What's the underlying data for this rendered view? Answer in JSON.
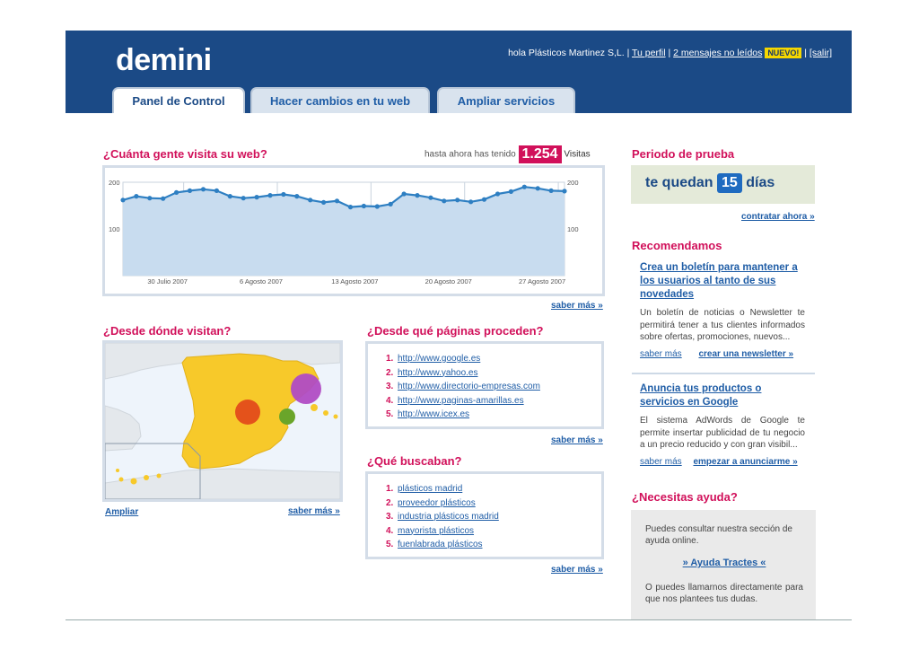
{
  "header": {
    "logo": "demini",
    "greeting": "hola Plásticos Martinez S,L. |",
    "profile_link": "Tu perfil",
    "sep1": "|",
    "messages_link": "2 mensajes no leídos",
    "new_badge": "NUEVO!",
    "sep2": "|",
    "logout_link": "[salir]"
  },
  "tabs": [
    {
      "label": "Panel de Control",
      "active": true
    },
    {
      "label": "Hacer cambios en tu web",
      "active": false
    },
    {
      "label": "Ampliar servicios",
      "active": false
    }
  ],
  "visits": {
    "title": "¿Cuánta gente visita su web?",
    "prefix": "hasta ahora has tenido",
    "count": "1.254",
    "suffix": "Visitas",
    "more": "saber más »"
  },
  "chart_data": {
    "type": "area",
    "y_tick_labels": [
      "200",
      "100"
    ],
    "ylim": [
      0,
      200
    ],
    "x_tick_labels": [
      "30 Julio 2007",
      "6 Agosto 2007",
      "13 Agosto 2007",
      "20 Agosto 2007",
      "27 Agosto 2007"
    ],
    "series": [
      {
        "values": [
          162,
          170,
          166,
          165,
          178,
          182,
          185,
          182,
          170,
          166,
          168,
          172,
          174,
          170,
          162,
          157,
          160,
          147,
          149,
          148,
          153,
          175,
          172,
          167,
          160,
          162,
          158,
          163,
          175,
          180,
          190,
          187,
          182,
          181
        ]
      }
    ],
    "grid": true,
    "colors": {
      "line": "#2e7fc2",
      "fill": "#c8dcef"
    }
  },
  "map": {
    "title": "¿Desde dónde visitan?",
    "expand_link": "Ampliar",
    "more": "saber más »",
    "colors": {
      "land": "#f7c92a",
      "sea": "#eef4fb",
      "other_land": "#e4e8ec",
      "dot_purple": "#b04cc4",
      "dot_orange": "#e4521b",
      "dot_green": "#6aa52a"
    }
  },
  "referrers": {
    "title": "¿Desde qué páginas proceden?",
    "items": [
      {
        "num": "1.",
        "url": "http://www.google.es"
      },
      {
        "num": "2.",
        "url": "http://www.yahoo.es"
      },
      {
        "num": "3.",
        "url": "http://www.directorio-empresas.com"
      },
      {
        "num": "4.",
        "url": "http://www.paginas-amarillas.es"
      },
      {
        "num": "5.",
        "url": "http://www.icex.es"
      }
    ],
    "more": "saber más »"
  },
  "searches": {
    "title": "¿Qué buscaban?",
    "items": [
      {
        "num": "1.",
        "term": "plásticos madrid"
      },
      {
        "num": "2.",
        "term": "proveedor plásticos"
      },
      {
        "num": "3.",
        "term": "industria plásticos madrid"
      },
      {
        "num": "4.",
        "term": "mayorista plásticos"
      },
      {
        "num": "5.",
        "term": "fuenlabrada plásticos"
      }
    ],
    "more": "saber más »"
  },
  "trial": {
    "title": "Periodo de prueba",
    "prefix": "te quedan",
    "days": "15",
    "suffix": "días",
    "hire_link": "contratar ahora »"
  },
  "recommend": {
    "title": "Recomendamos",
    "card1": {
      "headline": "Crea un boletín para mantener a los usuarios al tanto de sus novedades",
      "body": "Un boletín de noticias o Newsletter te permitirá tener a tus clientes informados sobre ofertas, promociones, nuevos...",
      "more": "saber más",
      "action": "crear una newsletter »"
    },
    "card2": {
      "headline": "Anuncia tus productos o servicios en Google",
      "body": "El sistema AdWords de Google te permite insertar publicidad de tu negocio a un precio reducido y con gran visibil...",
      "more": "saber más",
      "action": "empezar a anunciarme »"
    }
  },
  "help": {
    "title": "¿Necesitas ayuda?",
    "text1": "Puedes consultar nuestra sección de ayuda online.",
    "link": "» Ayuda Tractes «",
    "text2": "O puedes llamarnos directamente para que nos plantees tus dudas."
  }
}
